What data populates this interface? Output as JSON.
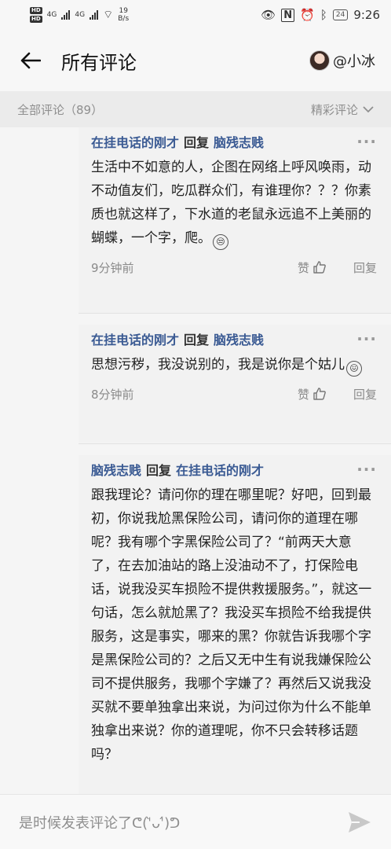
{
  "statusbar": {
    "hd1": "HD",
    "hd2": "HD",
    "net1": "4G",
    "net2": "4G",
    "speed_value": "19",
    "speed_unit": "B/s",
    "battery": "24",
    "time": "9:26"
  },
  "header": {
    "title": "所有评论",
    "username": "@小冰"
  },
  "filter": {
    "left": "全部评论（89）",
    "right": "精彩评论"
  },
  "comments": [
    {
      "author": "在挂电话的刚才",
      "verb": "回复",
      "target": "脑残志贱",
      "text": "生活中不如意的人，企图在网络上呼风唤雨，动不动值友们，吃瓜群众们，有谁理你？？？你素质也就这样了，下水道的老鼠永远追不上美丽的蝴蝶，一个字，爬。",
      "emoji": "😒",
      "time": "9分钟前",
      "like": "赞",
      "reply": "回复"
    },
    {
      "author": "在挂电话的刚才",
      "verb": "回复",
      "target": "脑残志贱",
      "text": "思想污秽，我没说别的，我是说你是个姑儿",
      "emoji": "😖",
      "time": "8分钟前",
      "like": "赞",
      "reply": "回复"
    },
    {
      "author": "脑残志贱",
      "verb": "回复",
      "target": "在挂电话的刚才",
      "text": "跟我理论？请问你的理在哪里呢？好吧，回到最初，你说我尬黑保险公司，请问你的道理在哪呢？我有哪个字黑保险公司了？“前两天大意了，在去加油站的路上没油动不了，打保险电话，说我没买车损险不提供救援服务。”，就这一句话，怎么就尬黑了？我没买车损险不给我提供服务，这是事实，哪来的黑？你就告诉我哪个字是黑保险公司的？之后又无中生有说我嫌保险公司不提供服务，我哪个字嫌了？再然后又说我没买就不要单独拿出来说，为问过你为什么不能单独拿出来说？你的道理呢，你不只会转移话题吗？"
    }
  ],
  "input": {
    "placeholder": "是时候发表评论了ᕦ(ˈ̀ᴗˈ́)ᕤ"
  },
  "icons": {
    "back": "arrow-left-icon",
    "more": "more-dots-icon",
    "thumb": "thumbs-up-icon",
    "send": "send-icon",
    "chevron": "chevron-down-icon"
  }
}
